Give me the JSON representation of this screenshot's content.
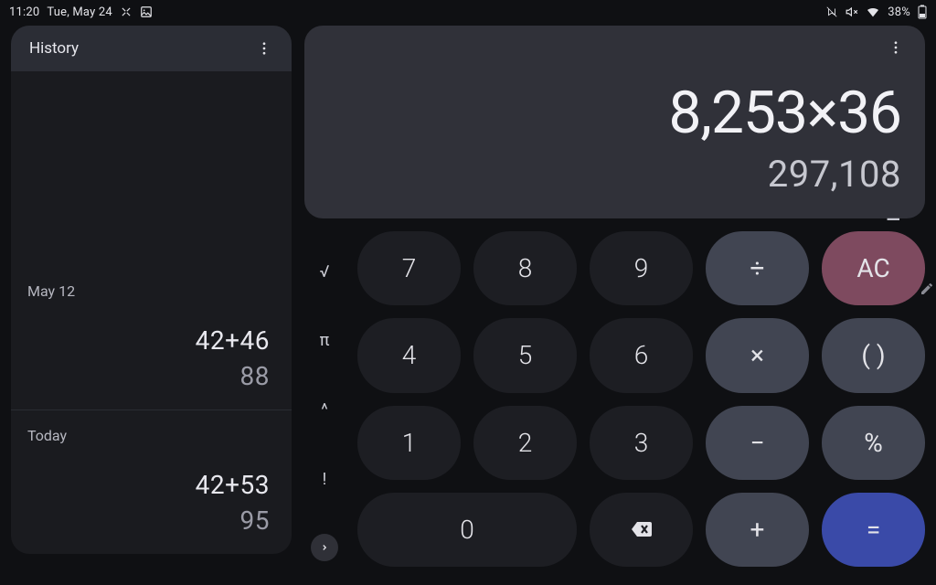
{
  "statusbar": {
    "time": "11:20",
    "date": "Tue, May 24",
    "battery": "38%"
  },
  "history": {
    "title": "History",
    "groups": [
      {
        "date": "May 12",
        "equation": "42+46",
        "result": "88"
      },
      {
        "date": "Today",
        "equation": "42+53",
        "result": "95"
      }
    ]
  },
  "display": {
    "expression": "8,253×36",
    "result": "297,108",
    "cursor": "_"
  },
  "functions": {
    "sqrt": "√",
    "pi": "π",
    "pow": "^",
    "fact": "!"
  },
  "keypad": {
    "n7": "7",
    "n8": "8",
    "n9": "9",
    "div": "÷",
    "ac": "AC",
    "n4": "4",
    "n5": "5",
    "n6": "6",
    "mul": "×",
    "paren": "( )",
    "n1": "1",
    "n2": "2",
    "n3": "3",
    "sub": "−",
    "pct": "%",
    "n0": "0",
    "add": "+",
    "eq": "="
  }
}
